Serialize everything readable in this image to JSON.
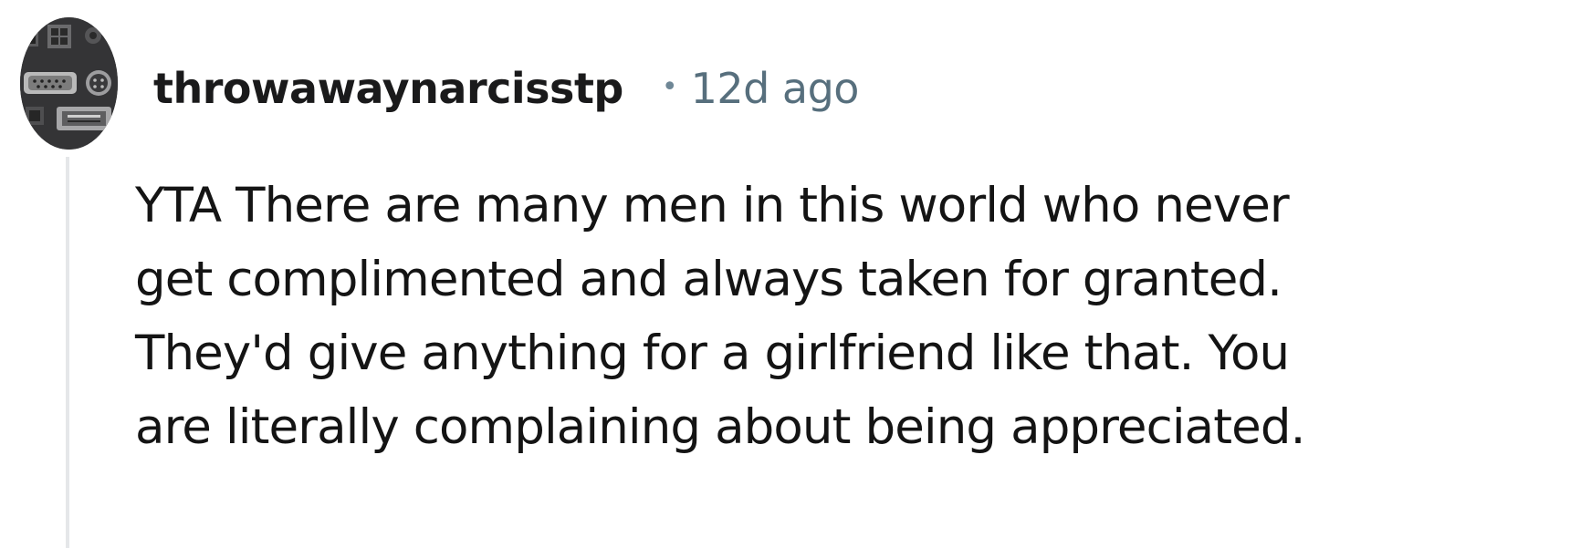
{
  "comment": {
    "author": "throwawaynarcisstp",
    "separator": "•",
    "time_ago": "12d ago",
    "body_lines": [
      "YTA There are many men in this world who never",
      "get complimented and always taken for granted.",
      "They'd give anything for a girlfriend like that. You",
      "are literally complaining about being appreciated."
    ]
  },
  "colors": {
    "username": "#1a1a1b",
    "timestamp": "#576f7d",
    "thread_line": "#e5e7e9",
    "body_text": "#141414"
  }
}
